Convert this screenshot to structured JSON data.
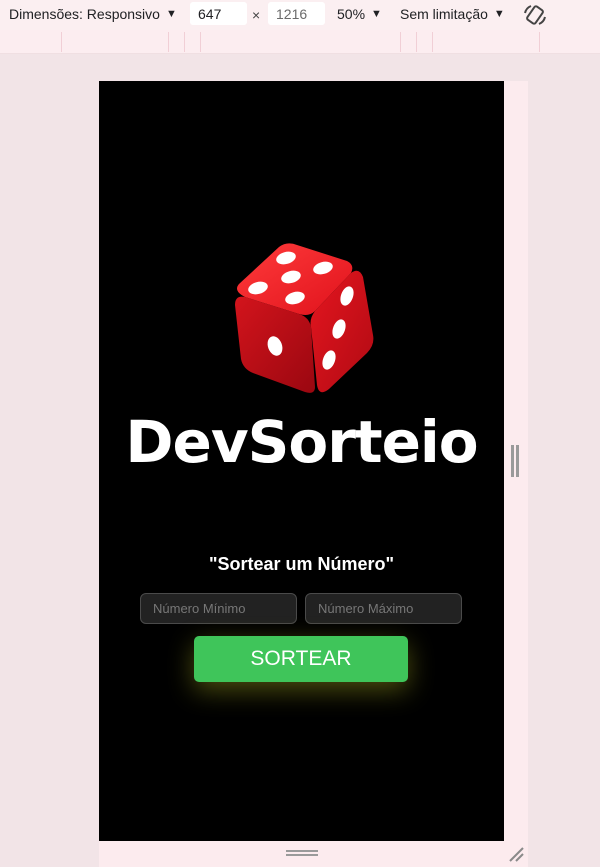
{
  "toolbar": {
    "dimensions_label": "Dimensões: Responsivo",
    "width_value": "647",
    "height_value": "1216",
    "times_symbol": "×",
    "zoom_label": "50%",
    "throttle_label": "Sem limitação",
    "icons": [
      "chevron-down-icon",
      "rotate-icon"
    ]
  },
  "app": {
    "logo_text": "DevSorteio",
    "subtitle": "\"Sortear um Número\"",
    "min_placeholder": "Número Mínimo",
    "max_placeholder": "Número Máximo",
    "button_label": "SORTEAR",
    "colors": {
      "background": "#000000",
      "button": "#3fc55a",
      "dice": "#d9141f"
    }
  }
}
